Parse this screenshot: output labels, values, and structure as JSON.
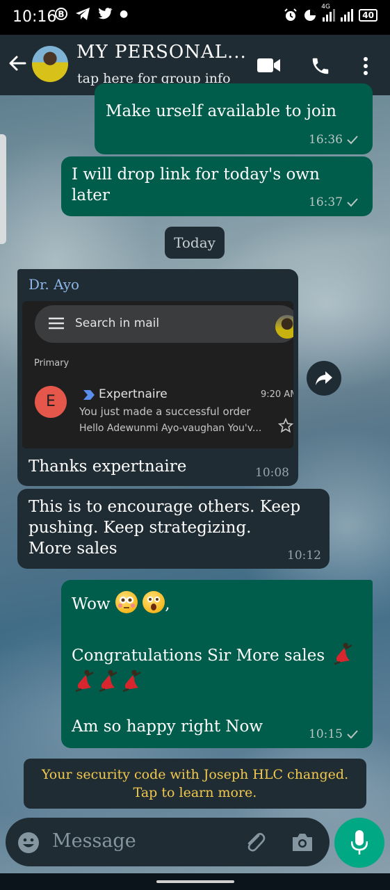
{
  "status_bar": {
    "time": "10:16",
    "network": "4G",
    "battery": "40"
  },
  "header": {
    "title": "MY PERSONAL...",
    "subtitle": "tap here for group info"
  },
  "messages": [
    {
      "text": "Make urself available to join",
      "time": "16:36"
    },
    {
      "text": "I will drop link for today's own\nlater",
      "time": "16:37"
    }
  ],
  "date_divider": "Today",
  "image_message": {
    "sender": "Dr. Ayo",
    "caption": "Thanks expertnaire",
    "time": "10:08",
    "email_screenshot": {
      "search_placeholder": "Search in mail",
      "section": "Primary",
      "sender_initial": "E",
      "sender": "Expertnaire",
      "time": "9:20 AM",
      "subject": "You just made a successful order",
      "preview": "Hello Adewunmi Ayo-vaughan You'v..."
    }
  },
  "incoming_text": {
    "text": "This is to encourage others. Keep\npushing. Keep strategizing.\nMore sales",
    "time": "10:12"
  },
  "reply": {
    "line1": "Wow",
    "line1_suffix": ",",
    "line2": "Congratulations Sir More sales",
    "line3": "Am so happy right Now",
    "time": "10:15"
  },
  "security_notice": "Your security code with Joseph HLC changed. Tap to learn more.",
  "composer": {
    "placeholder": "Message"
  },
  "colors": {
    "header_bg": "#1f2c34",
    "outgoing_bubble": "#005c4b",
    "incoming_bubble": "#1f2c34",
    "mic_button": "#00a884",
    "notice_text": "#f2c94c"
  }
}
